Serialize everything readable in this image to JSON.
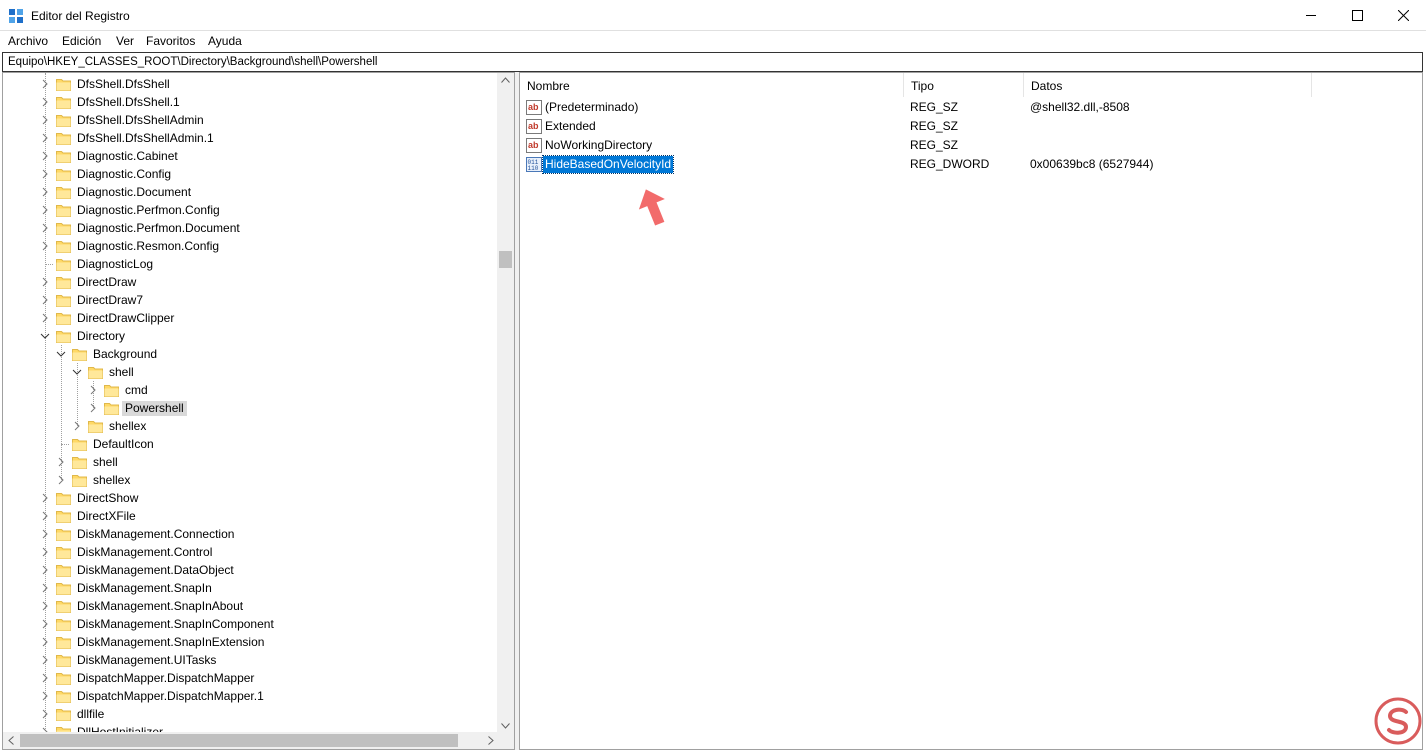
{
  "window": {
    "title": "Editor del Registro"
  },
  "menu": [
    "Archivo",
    "Edición",
    "Ver",
    "Favoritos",
    "Ayuda"
  ],
  "address": "Equipo\\HKEY_CLASSES_ROOT\\Directory\\Background\\shell\\Powershell",
  "tree": {
    "items": [
      {
        "label": "DfsShell.DfsShell",
        "level": 0,
        "exp": "collapsed"
      },
      {
        "label": "DfsShell.DfsShell.1",
        "level": 0,
        "exp": "collapsed"
      },
      {
        "label": "DfsShell.DfsShellAdmin",
        "level": 0,
        "exp": "collapsed"
      },
      {
        "label": "DfsShell.DfsShellAdmin.1",
        "level": 0,
        "exp": "collapsed"
      },
      {
        "label": "Diagnostic.Cabinet",
        "level": 0,
        "exp": "collapsed"
      },
      {
        "label": "Diagnostic.Config",
        "level": 0,
        "exp": "collapsed"
      },
      {
        "label": "Diagnostic.Document",
        "level": 0,
        "exp": "collapsed"
      },
      {
        "label": "Diagnostic.Perfmon.Config",
        "level": 0,
        "exp": "collapsed"
      },
      {
        "label": "Diagnostic.Perfmon.Document",
        "level": 0,
        "exp": "collapsed"
      },
      {
        "label": "Diagnostic.Resmon.Config",
        "level": 0,
        "exp": "collapsed"
      },
      {
        "label": "DiagnosticLog",
        "level": 0,
        "exp": "none"
      },
      {
        "label": "DirectDraw",
        "level": 0,
        "exp": "collapsed"
      },
      {
        "label": "DirectDraw7",
        "level": 0,
        "exp": "collapsed"
      },
      {
        "label": "DirectDrawClipper",
        "level": 0,
        "exp": "collapsed"
      },
      {
        "label": "Directory",
        "level": 0,
        "exp": "expanded"
      },
      {
        "label": "Background",
        "level": 1,
        "exp": "expanded"
      },
      {
        "label": "shell",
        "level": 2,
        "exp": "expanded"
      },
      {
        "label": "cmd",
        "level": 3,
        "exp": "collapsed"
      },
      {
        "label": "Powershell",
        "level": 3,
        "exp": "collapsed",
        "selected": true
      },
      {
        "label": "shellex",
        "level": 2,
        "exp": "collapsed"
      },
      {
        "label": "DefaultIcon",
        "level": 1,
        "exp": "none"
      },
      {
        "label": "shell",
        "level": 1,
        "exp": "collapsed"
      },
      {
        "label": "shellex",
        "level": 1,
        "exp": "collapsed"
      },
      {
        "label": "DirectShow",
        "level": 0,
        "exp": "collapsed"
      },
      {
        "label": "DirectXFile",
        "level": 0,
        "exp": "collapsed"
      },
      {
        "label": "DiskManagement.Connection",
        "level": 0,
        "exp": "collapsed"
      },
      {
        "label": "DiskManagement.Control",
        "level": 0,
        "exp": "collapsed"
      },
      {
        "label": "DiskManagement.DataObject",
        "level": 0,
        "exp": "collapsed"
      },
      {
        "label": "DiskManagement.SnapIn",
        "level": 0,
        "exp": "collapsed"
      },
      {
        "label": "DiskManagement.SnapInAbout",
        "level": 0,
        "exp": "collapsed"
      },
      {
        "label": "DiskManagement.SnapInComponent",
        "level": 0,
        "exp": "collapsed"
      },
      {
        "label": "DiskManagement.SnapInExtension",
        "level": 0,
        "exp": "collapsed"
      },
      {
        "label": "DiskManagement.UITasks",
        "level": 0,
        "exp": "collapsed"
      },
      {
        "label": "DispatchMapper.DispatchMapper",
        "level": 0,
        "exp": "collapsed"
      },
      {
        "label": "DispatchMapper.DispatchMapper.1",
        "level": 0,
        "exp": "collapsed"
      },
      {
        "label": "dllfile",
        "level": 0,
        "exp": "collapsed"
      },
      {
        "label": "DllHostInitializer",
        "level": 0,
        "exp": "collapsed"
      }
    ]
  },
  "list": {
    "columns": [
      "Nombre",
      "Tipo",
      "Datos"
    ],
    "rows": [
      {
        "name": "(Predeterminado)",
        "type": "REG_SZ",
        "data": "@shell32.dll,-8508",
        "icon": "string-value-icon"
      },
      {
        "name": "Extended",
        "type": "REG_SZ",
        "data": "",
        "icon": "string-value-icon"
      },
      {
        "name": "NoWorkingDirectory",
        "type": "REG_SZ",
        "data": "",
        "icon": "string-value-icon"
      },
      {
        "name": "HideBasedOnVelocityId",
        "type": "REG_DWORD",
        "data": "0x00639bc8 (6527944)",
        "icon": "binary-value-icon",
        "selected": true
      }
    ]
  },
  "colors": {
    "selection": "#0078d7",
    "folder": "#ffd966",
    "annotation_arrow": "#f26b6b",
    "watermark": "#d95c5c"
  },
  "icons": {
    "app": "regedit-icon",
    "minimize": "minimize-icon",
    "maximize": "maximize-icon",
    "close": "close-icon",
    "watermark": "logo-watermark-icon"
  }
}
